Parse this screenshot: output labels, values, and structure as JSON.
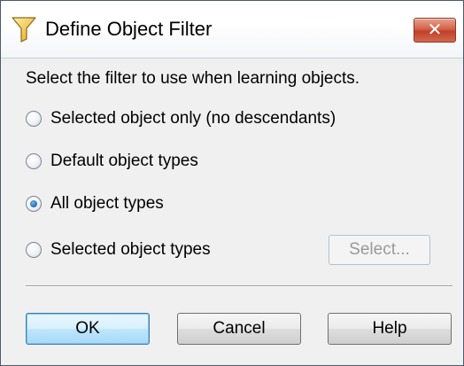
{
  "window": {
    "title": "Define Object Filter",
    "close_label": "✕",
    "title_icon": "funnel-filter-icon"
  },
  "description": "Select the filter to use when learning objects.",
  "filter_options": [
    {
      "label": "Selected object only (no descendants)",
      "checked": false
    },
    {
      "label": "Default object types",
      "checked": false
    },
    {
      "label": "All object types",
      "checked": true
    },
    {
      "label": "Selected object types",
      "checked": false
    }
  ],
  "select_button": {
    "label": "Select...",
    "enabled": false
  },
  "buttons": {
    "ok": "OK",
    "cancel": "Cancel",
    "help": "Help"
  },
  "colors": {
    "close_button": "#c9452c",
    "default_button_border": "#3c7fb1",
    "radio_checked": "#1a5ea8",
    "dialog_background": "#f0f0f0"
  }
}
